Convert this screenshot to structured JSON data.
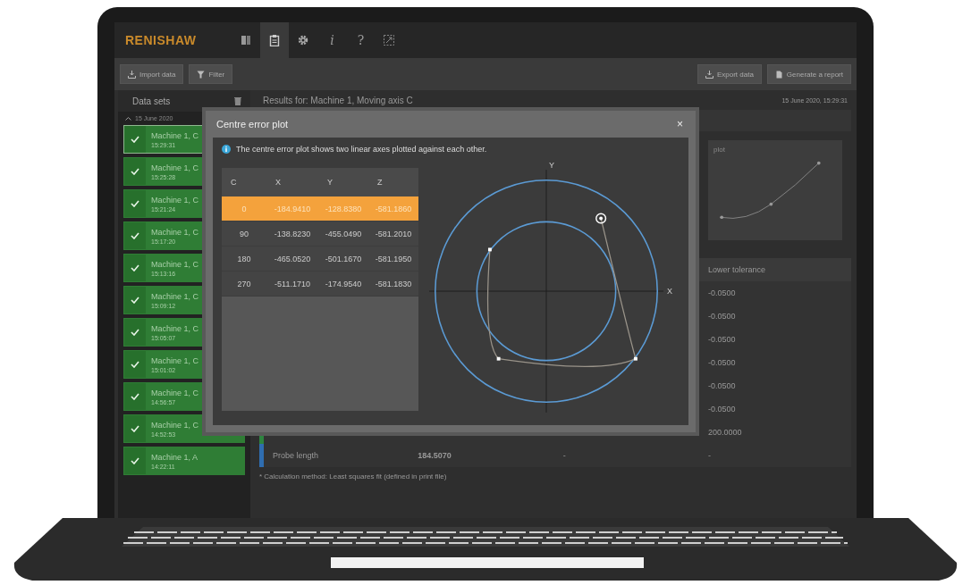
{
  "app": {
    "logo": "RENISHAW",
    "tabs": [
      {
        "kind": "icon",
        "selected": false
      },
      {
        "kind": "icon",
        "selected": true
      },
      {
        "kind": "icon",
        "selected": false
      },
      {
        "kind": "text",
        "label": "i",
        "selected": false
      },
      {
        "kind": "text",
        "label": "?",
        "selected": false
      },
      {
        "kind": "icon",
        "selected": false
      }
    ],
    "toolbar_left": [
      "Import data",
      "Filter"
    ],
    "toolbar_right": [
      "Export data",
      "Generate a report"
    ]
  },
  "sidebar": {
    "title": "Data sets",
    "group": "15 June 2020",
    "expanded": true,
    "items": [
      {
        "name": "Machine 1, C",
        "time": "15:29:31",
        "selected": true
      },
      {
        "name": "Machine 1, C",
        "time": "15:25:28",
        "selected": false
      },
      {
        "name": "Machine 1, C",
        "time": "15:21:24",
        "selected": false
      },
      {
        "name": "Machine 1, C",
        "time": "15:17:20",
        "selected": false
      },
      {
        "name": "Machine 1, C",
        "time": "15:13:16",
        "selected": false
      },
      {
        "name": "Machine 1, C",
        "time": "15:09:12",
        "selected": false
      },
      {
        "name": "Machine 1, C",
        "time": "15:05:07",
        "selected": false
      },
      {
        "name": "Machine 1, C",
        "time": "15:01:02",
        "selected": false
      },
      {
        "name": "Machine 1, C",
        "time": "14:56:57",
        "selected": false
      },
      {
        "name": "Machine 1, C",
        "time": "14:52:53",
        "selected": false
      },
      {
        "name": "Machine 1, A",
        "time": "14:22:11",
        "selected": false
      }
    ]
  },
  "results": {
    "title": "Results for: Machine 1, Moving axis C",
    "timestamp": "15 June 2020, 15:29:31",
    "chart_title": "plot",
    "table": {
      "column_4": "Lower tolerance",
      "rows": [
        {
          "lower_tolerance": "-0.0500"
        },
        {
          "lower_tolerance": "-0.0500"
        },
        {
          "lower_tolerance": "-0.0500"
        },
        {
          "lower_tolerance": "-0.0500"
        },
        {
          "lower_tolerance": "-0.0500"
        },
        {
          "lower_tolerance": "-0.0500"
        },
        {
          "lower_tolerance": "200.0000",
          "color": "#2e8540"
        },
        {
          "parameter": "Probe length",
          "value": "184.5070",
          "column_3": "-",
          "lower_tolerance": "-",
          "color": "#2f6db0"
        }
      ]
    },
    "footnote": "* Calculation method: Least squares fit (defined in print file)"
  },
  "dialog": {
    "title": "Centre error plot",
    "close": "×",
    "info": "The centre error plot shows two linear axes plotted against each other.",
    "table": {
      "columns": [
        "C",
        "X",
        "Y",
        "Z"
      ],
      "rows": [
        {
          "cells": [
            "0",
            "-184.9410",
            "-128.8380",
            "-581.1860"
          ],
          "selected": true
        },
        {
          "cells": [
            "90",
            "-138.8230",
            "-455.0490",
            "-581.2010"
          ],
          "selected": false
        },
        {
          "cells": [
            "180",
            "-465.0520",
            "-501.1670",
            "-581.1950"
          ],
          "selected": false
        },
        {
          "cells": [
            "270",
            "-511.1710",
            "-174.9540",
            "-581.1830"
          ],
          "selected": false
        }
      ]
    },
    "plot": {
      "x_label": "X",
      "y_label": "Y"
    }
  }
}
